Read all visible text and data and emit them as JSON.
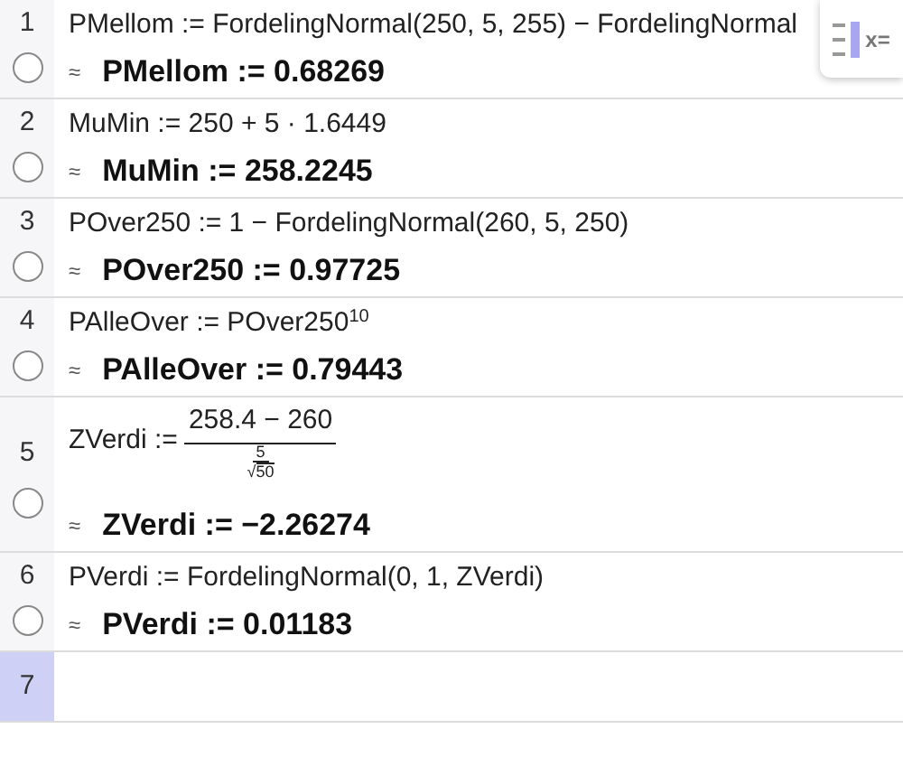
{
  "rows": [
    {
      "number": "1",
      "selected": false,
      "input": {
        "kind": "plain",
        "text": "PMellom := FordelingNormal(250, 5, 255) − FordelingNormal"
      },
      "approx": "≈",
      "output": "PMellom := 0.68269"
    },
    {
      "number": "2",
      "selected": false,
      "input": {
        "kind": "plain",
        "text": "MuMin := 250 + 5 · 1.6449"
      },
      "approx": "≈",
      "output": "MuMin := 258.2245"
    },
    {
      "number": "3",
      "selected": false,
      "input": {
        "kind": "plain",
        "text": "POver250 := 1 − FordelingNormal(260, 5, 250)"
      },
      "approx": "≈",
      "output": "POver250 := 0.97725"
    },
    {
      "number": "4",
      "selected": false,
      "input": {
        "kind": "power",
        "text": "PAlleOver := POver250",
        "exponent": "10"
      },
      "approx": "≈",
      "output": "PAlleOver := 0.79443"
    },
    {
      "number": "5",
      "selected": false,
      "input": {
        "kind": "fraction",
        "text": "ZVerdi :=",
        "numerator": "258.4 − 260",
        "inner_numerator": "5",
        "radical": "√",
        "radicand": "50"
      },
      "approx": "≈",
      "output": "ZVerdi := −2.26274"
    },
    {
      "number": "6",
      "selected": false,
      "input": {
        "kind": "plain",
        "text": "PVerdi := FordelingNormal(0, 1, ZVerdi)"
      },
      "approx": "≈",
      "output": "PVerdi := 0.01183"
    },
    {
      "number": "7",
      "selected": true
    }
  ],
  "keyboard_toggle": {
    "label": "x="
  }
}
